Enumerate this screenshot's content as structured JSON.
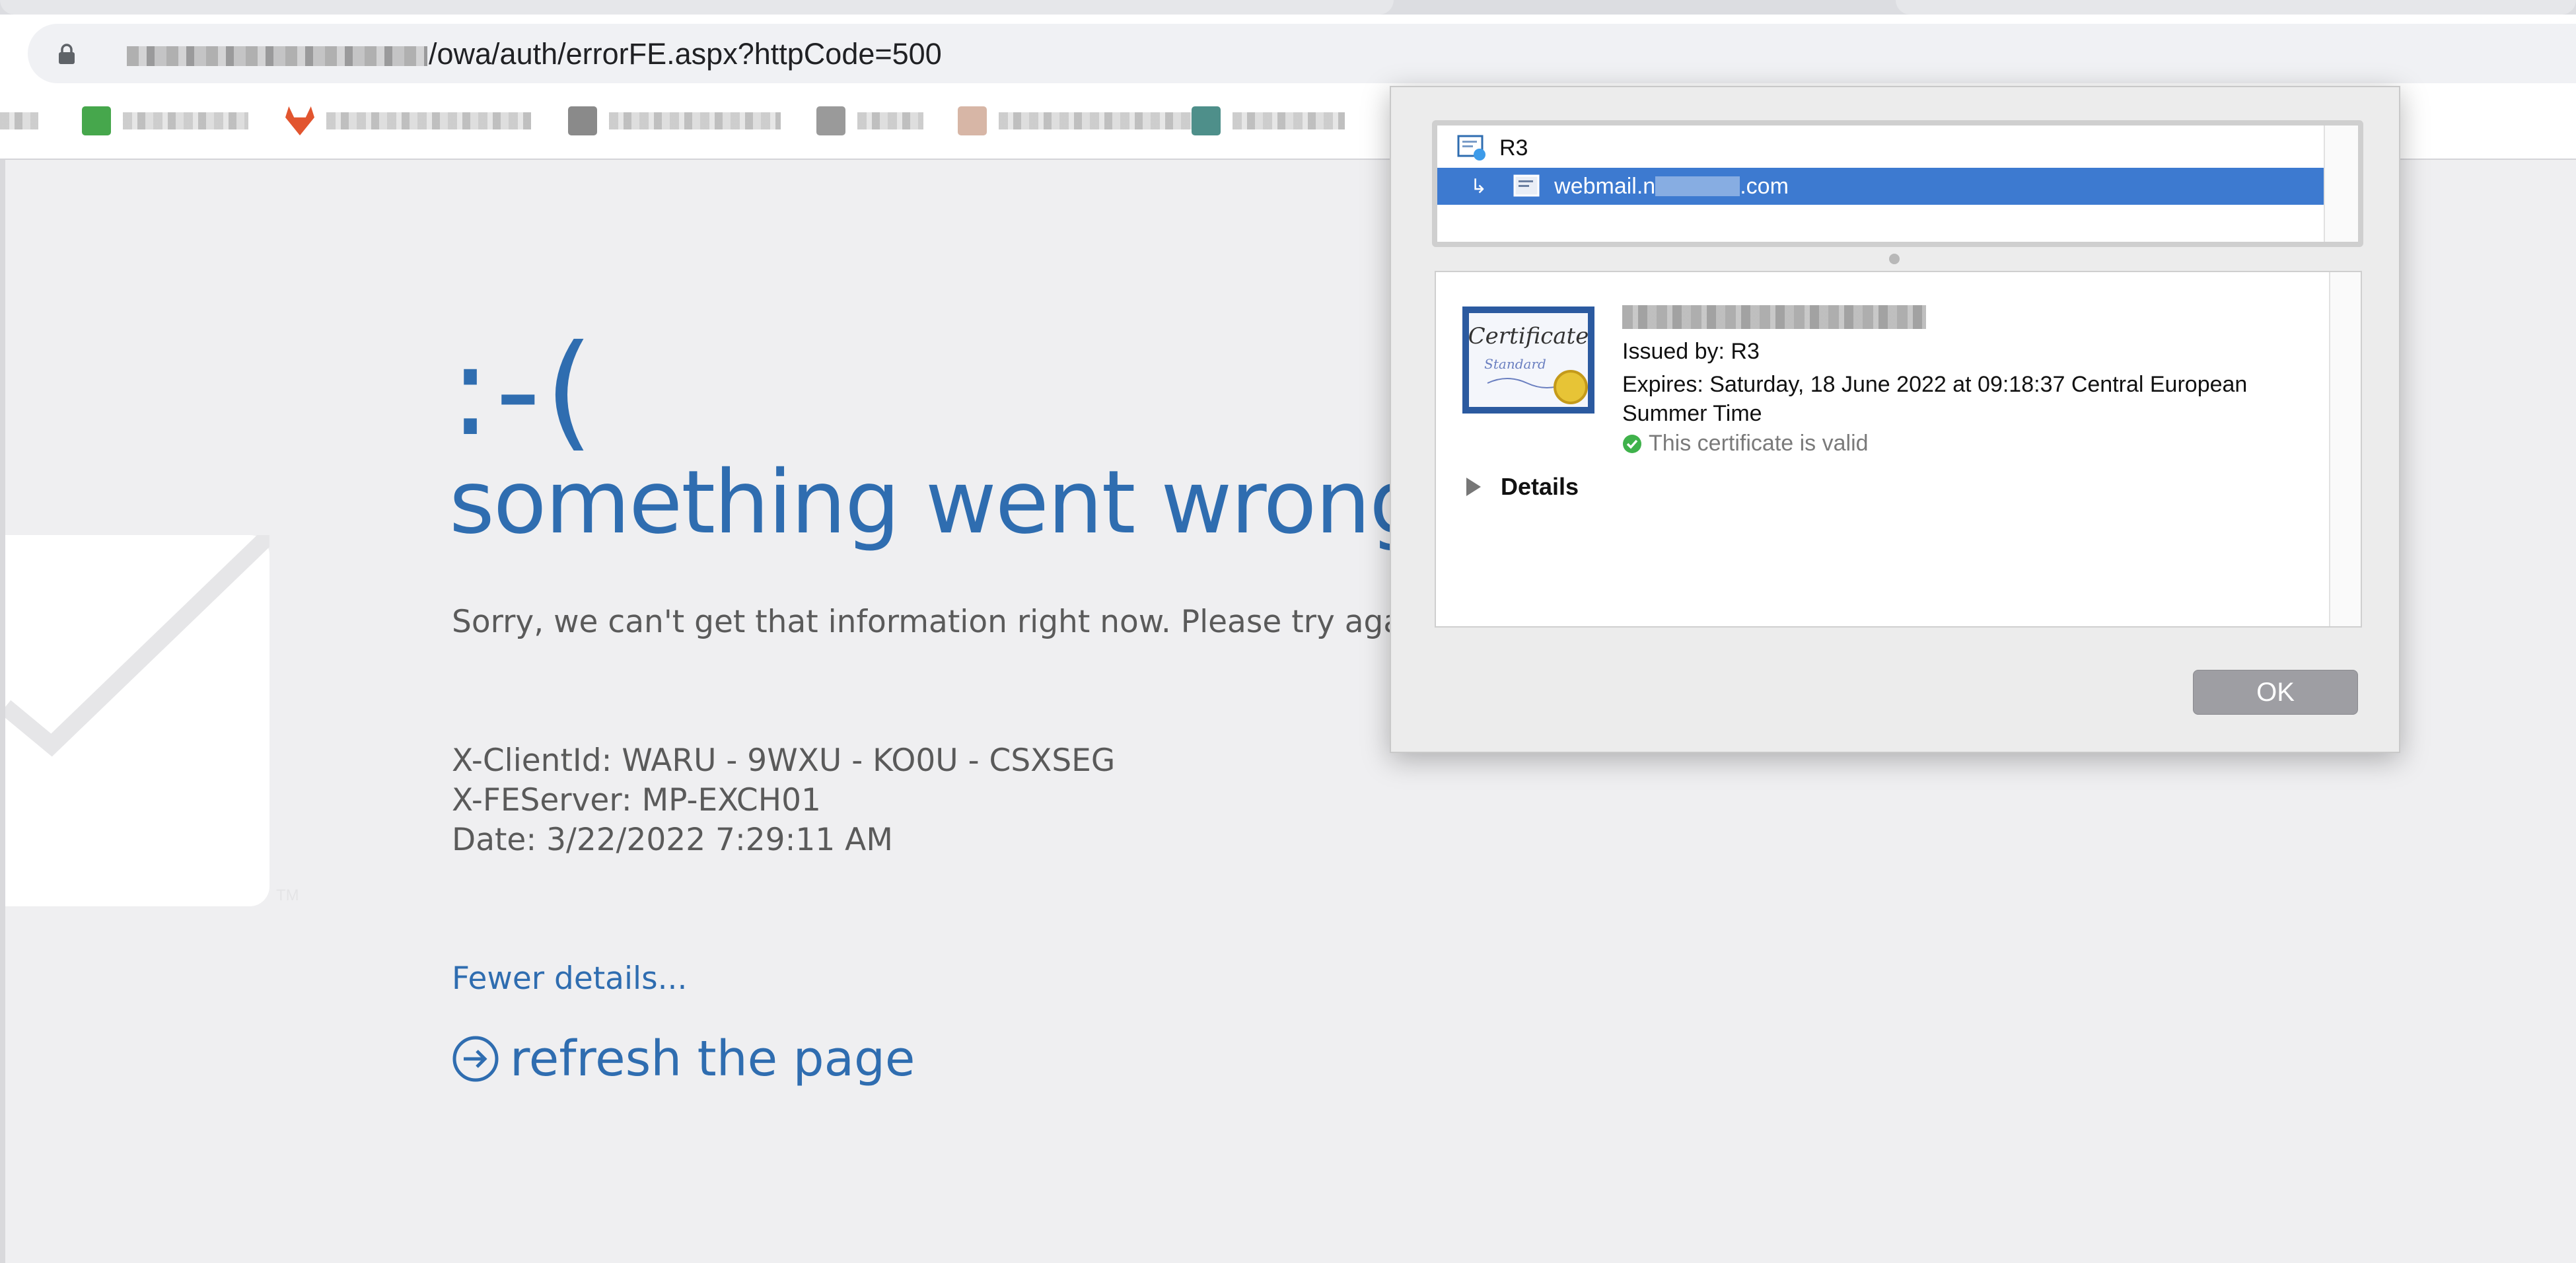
{
  "browser": {
    "url_path": "/owa/auth/errorFE.aspx?httpCode=500",
    "lock_icon": "lock-icon",
    "bookmark_icons": [
      "green-grid-icon",
      "gitlab-fox-icon",
      "spreadsheet-icon",
      "folder-icon",
      "doc-icon",
      "image-icon"
    ]
  },
  "error_page": {
    "emoticon": ":-(",
    "headline": "something went wrong",
    "message": "Sorry, we can't get that information right now. Please try again late",
    "client_id": "X-ClientId: WARU - 9WXU - KO0U - CSXSEG",
    "fe_server": "X-FEServer: MP-EXCH01",
    "date": "Date: 3/22/2022 7:29:11 AM",
    "fewer_details": "Fewer details...",
    "refresh": "refresh the page",
    "trademark": "TM"
  },
  "certificate_dialog": {
    "chain_root": "R3",
    "chain_leaf_prefix": "webmail.n",
    "chain_leaf_suffix": ".com",
    "issued_by": "Issued by: R3",
    "expires_line1": "Expires: Saturday, 18 June 2022 at 09:18:37 Central European",
    "expires_line2": "Summer Time",
    "valid_text": "This certificate is valid",
    "details_label": "Details",
    "ok_label": "OK",
    "cert_badge_text": "Certificate",
    "cert_badge_sub": "Standard"
  },
  "colors": {
    "accent_blue": "#2f6db0",
    "selection_blue": "#3d7ad0",
    "valid_green": "#3fb24b"
  }
}
